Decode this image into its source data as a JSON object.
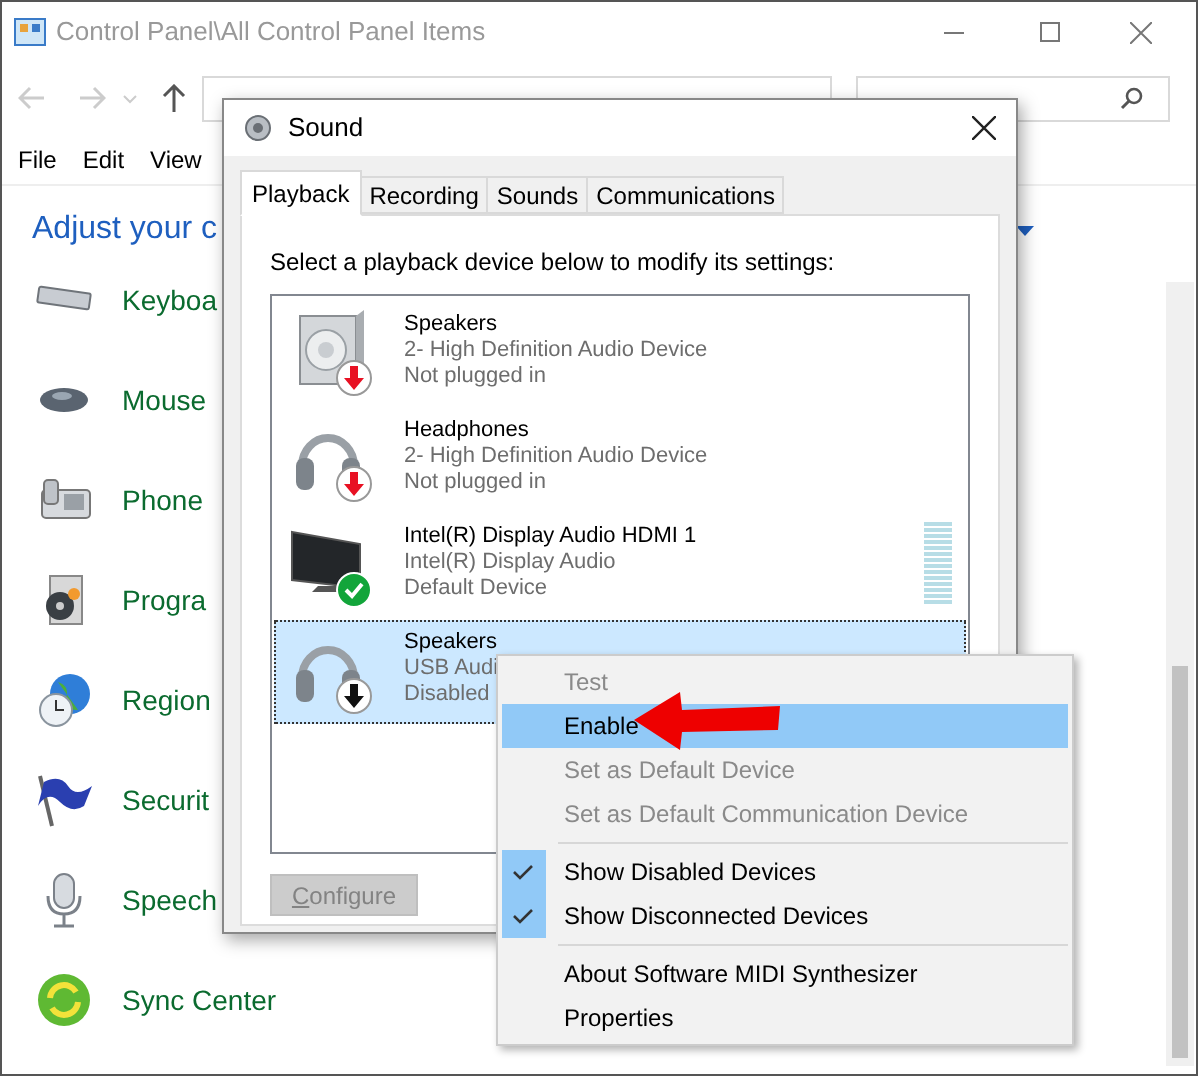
{
  "window": {
    "title": "Control Panel\\All Control Panel Items"
  },
  "menu_bar": [
    "File",
    "Edit",
    "View"
  ],
  "heading": "Adjust your c",
  "items": [
    {
      "label": "Keyboa"
    },
    {
      "label": "Mouse"
    },
    {
      "label": "Phone"
    },
    {
      "label": "Progra"
    },
    {
      "label": "Region"
    },
    {
      "label": "Securit"
    },
    {
      "label": "Speech"
    },
    {
      "label": "Sync Center"
    }
  ],
  "dialog": {
    "title": "Sound",
    "tabs": [
      {
        "label": "Playback",
        "selected": true
      },
      {
        "label": "Recording",
        "selected": false
      },
      {
        "label": "Sounds",
        "selected": false
      },
      {
        "label": "Communications",
        "selected": false
      }
    ],
    "instruction": "Select a playback device below to modify its settings:",
    "devices": [
      {
        "name": "Speakers",
        "line_2": "2- High Definition Audio Device",
        "line_3": "Not plugged in",
        "kind": "speaker",
        "plugged_in": false,
        "default": false,
        "enabled": true,
        "selected": false
      },
      {
        "name": "Headphones",
        "line_2": "2- High Definition Audio Device",
        "line_3": "Not plugged in",
        "kind": "headphones",
        "plugged_in": false,
        "default": false,
        "enabled": true,
        "selected": false
      },
      {
        "name": "Intel(R) Display Audio HDMI 1",
        "line_2": "Intel(R) Display Audio",
        "line_3": "Default Device",
        "kind": "monitor",
        "plugged_in": true,
        "default": true,
        "enabled": true,
        "selected": false
      },
      {
        "name": "Speakers",
        "line_2": "USB Audi",
        "line_3": "Disabled",
        "kind": "headphones",
        "default": false,
        "enabled": false,
        "selected": true
      }
    ],
    "configure_button": {
      "label": "Configure",
      "disabled": true
    }
  },
  "context_menu": {
    "items": [
      {
        "kind": "item",
        "label": "Test",
        "disabled": true,
        "checked": false,
        "selected": false
      },
      {
        "kind": "item",
        "label": "Enable",
        "disabled": false,
        "checked": false,
        "selected": true
      },
      {
        "kind": "item",
        "label": "Set as Default Device",
        "disabled": true,
        "checked": false,
        "selected": false
      },
      {
        "kind": "item",
        "label": "Set as Default Communication Device",
        "disabled": true,
        "checked": false,
        "selected": false
      },
      {
        "kind": "separator"
      },
      {
        "kind": "item",
        "label": "Show Disabled Devices",
        "disabled": false,
        "checked": true,
        "selected": false
      },
      {
        "kind": "item",
        "label": "Show Disconnected Devices",
        "disabled": false,
        "checked": true,
        "selected": false
      },
      {
        "kind": "separator"
      },
      {
        "kind": "item",
        "label": "About Software MIDI Synthesizer",
        "disabled": false,
        "checked": false,
        "selected": false
      },
      {
        "kind": "item",
        "label": "Properties",
        "disabled": false,
        "checked": false,
        "selected": false
      }
    ]
  }
}
